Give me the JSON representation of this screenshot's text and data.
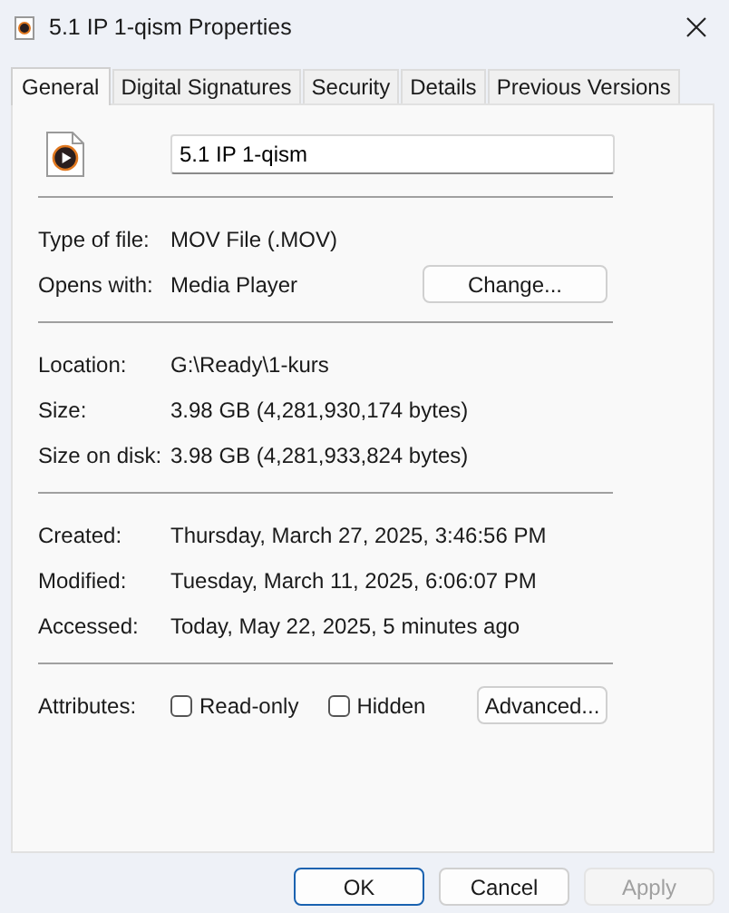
{
  "window": {
    "title": "5.1 IP 1-qism Properties"
  },
  "tabs": [
    {
      "label": "General",
      "selected": true
    },
    {
      "label": "Digital Signatures",
      "selected": false
    },
    {
      "label": "Security",
      "selected": false
    },
    {
      "label": "Details",
      "selected": false
    },
    {
      "label": "Previous Versions",
      "selected": false
    }
  ],
  "file_name": {
    "value": "5.1 IP 1-qism"
  },
  "sections": [
    {
      "rows": [
        {
          "label": "Type of file:",
          "value": "MOV File (.MOV)"
        },
        {
          "label": "Opens with:",
          "value": "Media Player",
          "button": "Change..."
        }
      ]
    },
    {
      "rows": [
        {
          "label": "Location:",
          "value": "G:\\Ready\\1-kurs"
        },
        {
          "label": "Size:",
          "value": "3.98 GB (4,281,930,174 bytes)"
        },
        {
          "label": "Size on disk:",
          "value": "3.98 GB (4,281,933,824 bytes)"
        }
      ]
    },
    {
      "rows": [
        {
          "label": "Created:",
          "value": "Thursday, March 27, 2025, 3:46:56 PM"
        },
        {
          "label": "Modified:",
          "value": "Tuesday, March 11, 2025, 6:06:07 PM"
        },
        {
          "label": "Accessed:",
          "value": "Today, May 22, 2025, 5 minutes ago"
        }
      ]
    }
  ],
  "attributes": {
    "label": "Attributes:",
    "checkboxes": [
      {
        "label": "Read-only",
        "checked": false
      },
      {
        "label": "Hidden",
        "checked": false
      }
    ],
    "button": "Advanced..."
  },
  "buttons": [
    {
      "label": "OK",
      "default": true,
      "disabled": false
    },
    {
      "label": "Cancel",
      "default": false,
      "disabled": false
    },
    {
      "label": "Apply",
      "default": false,
      "disabled": true
    }
  ]
}
